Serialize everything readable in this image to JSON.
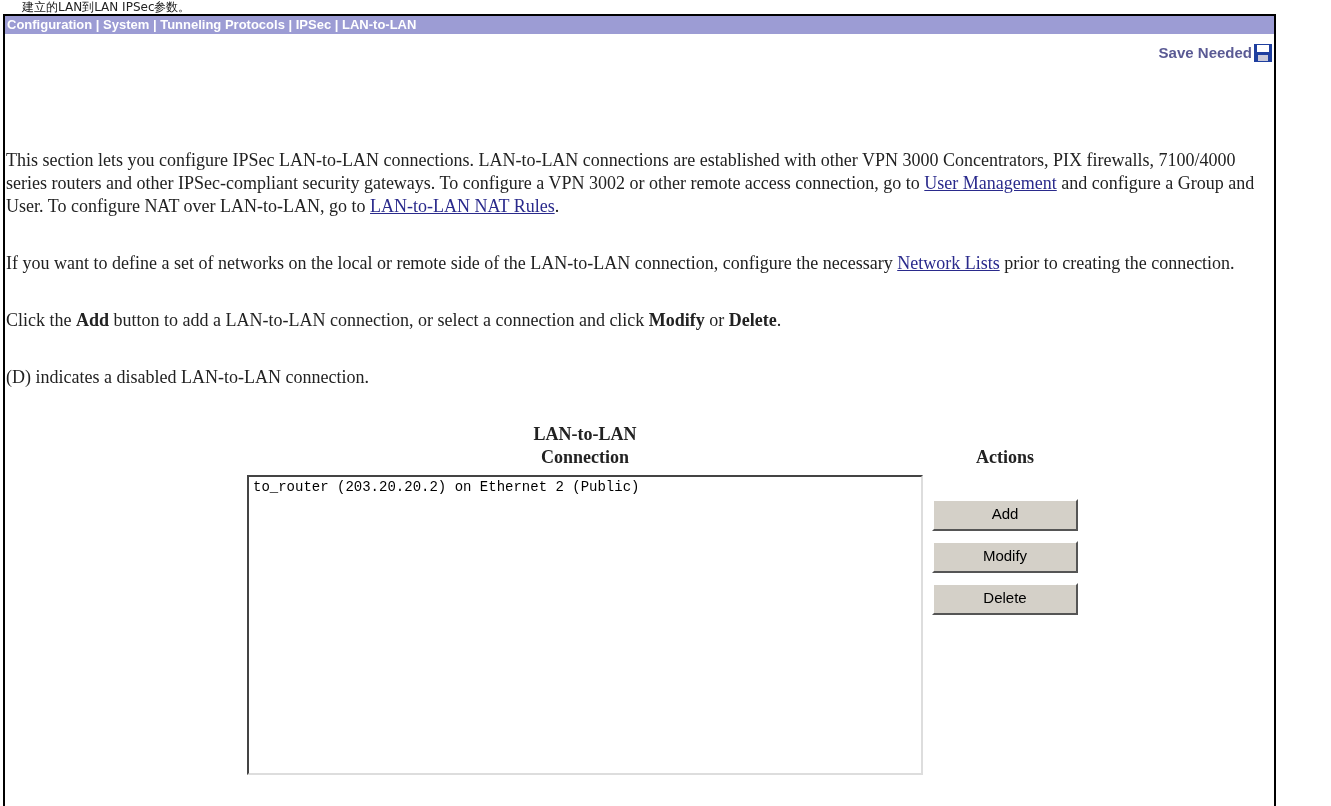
{
  "caption": "建立的LAN到LAN IPSec参数。",
  "breadcrumb": "Configuration | System | Tunneling Protocols | IPSec | LAN-to-LAN",
  "save_status": "Save Needed",
  "paragraphs": [
    [
      {
        "kind": "text",
        "text": "This section lets you configure IPSec LAN-to-LAN connections. LAN-to-LAN connections are established with other VPN 3000 Concentrators, PIX firewalls, 7100/4000 series routers and other IPSec-compliant security gateways. To configure a VPN 3002 or other remote access connection, go to "
      },
      {
        "kind": "link",
        "text": "User Management"
      },
      {
        "kind": "text",
        "text": " and configure a Group and User. To configure NAT over LAN-to-LAN, go to "
      },
      {
        "kind": "link",
        "text": "LAN-to-LAN NAT Rules"
      },
      {
        "kind": "text",
        "text": "."
      }
    ],
    [
      {
        "kind": "text",
        "text": "If you want to define a set of networks on the local or remote side of the LAN-to-LAN connection, configure the necessary "
      },
      {
        "kind": "link",
        "text": "Network Lists"
      },
      {
        "kind": "text",
        "text": " prior to creating the connection."
      }
    ],
    [
      {
        "kind": "text",
        "text": "Click the **Add** button to add a LAN-to-LAN connection, or select a connection and click **Modify** or **Delete**."
      }
    ],
    [
      {
        "kind": "text",
        "text": "(D) indicates a disabled LAN-to-LAN connection."
      }
    ]
  ],
  "table": {
    "columns": [
      "LAN-to-LAN Connection",
      "Actions"
    ],
    "connections": [
      {
        "label": "to_router (203.20.20.2) on Ethernet 2 (Public)",
        "selected": false
      }
    ],
    "actions": [
      "Add",
      "Modify",
      "Delete"
    ]
  }
}
